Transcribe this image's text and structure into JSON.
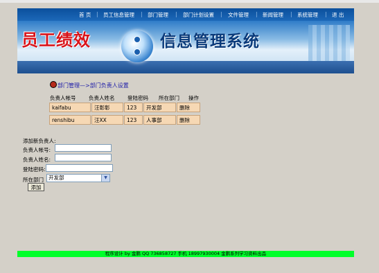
{
  "nav": {
    "items": [
      "首 页",
      "员工信息管理",
      "部门管理",
      "部门计划设置",
      "文件管理",
      "新闻管理",
      "系统管理",
      "退 出"
    ]
  },
  "banner": {
    "title_left": "员工绩效",
    "title_right": "信息管理系统"
  },
  "breadcrumb": "部门管理—>部门负责人设置",
  "table": {
    "headers": [
      "负责人帐号",
      "负责人姓名",
      "登陆密码",
      "所在部门",
      "操作"
    ],
    "rows": [
      {
        "account": "kaifabu",
        "name": "汪彰彰",
        "password": "123",
        "dept": "开发部",
        "action": "删除"
      },
      {
        "account": "renshibu",
        "name": "汪XX",
        "password": "123",
        "dept": "人事部",
        "action": "删除"
      }
    ]
  },
  "form": {
    "title": "添加新负责人:",
    "account_label": "负责人帐号:",
    "name_label": "负责人姓名:",
    "password_label": "登陆密码:",
    "dept_label": "所在部门",
    "dept_selected": "开发部",
    "submit_label": "添加"
  },
  "footer": "程序设计 by 金鹏  QQ 736858727 手机 18997930004 金鹏系列学习资料出品",
  "colors": {
    "footer_bg": "#00ff2a",
    "row_bg": "#f6d8b4",
    "breadcrumb": "#1b1aa8",
    "title_left": "#d8141b",
    "title_right": "#0a3a7a"
  }
}
